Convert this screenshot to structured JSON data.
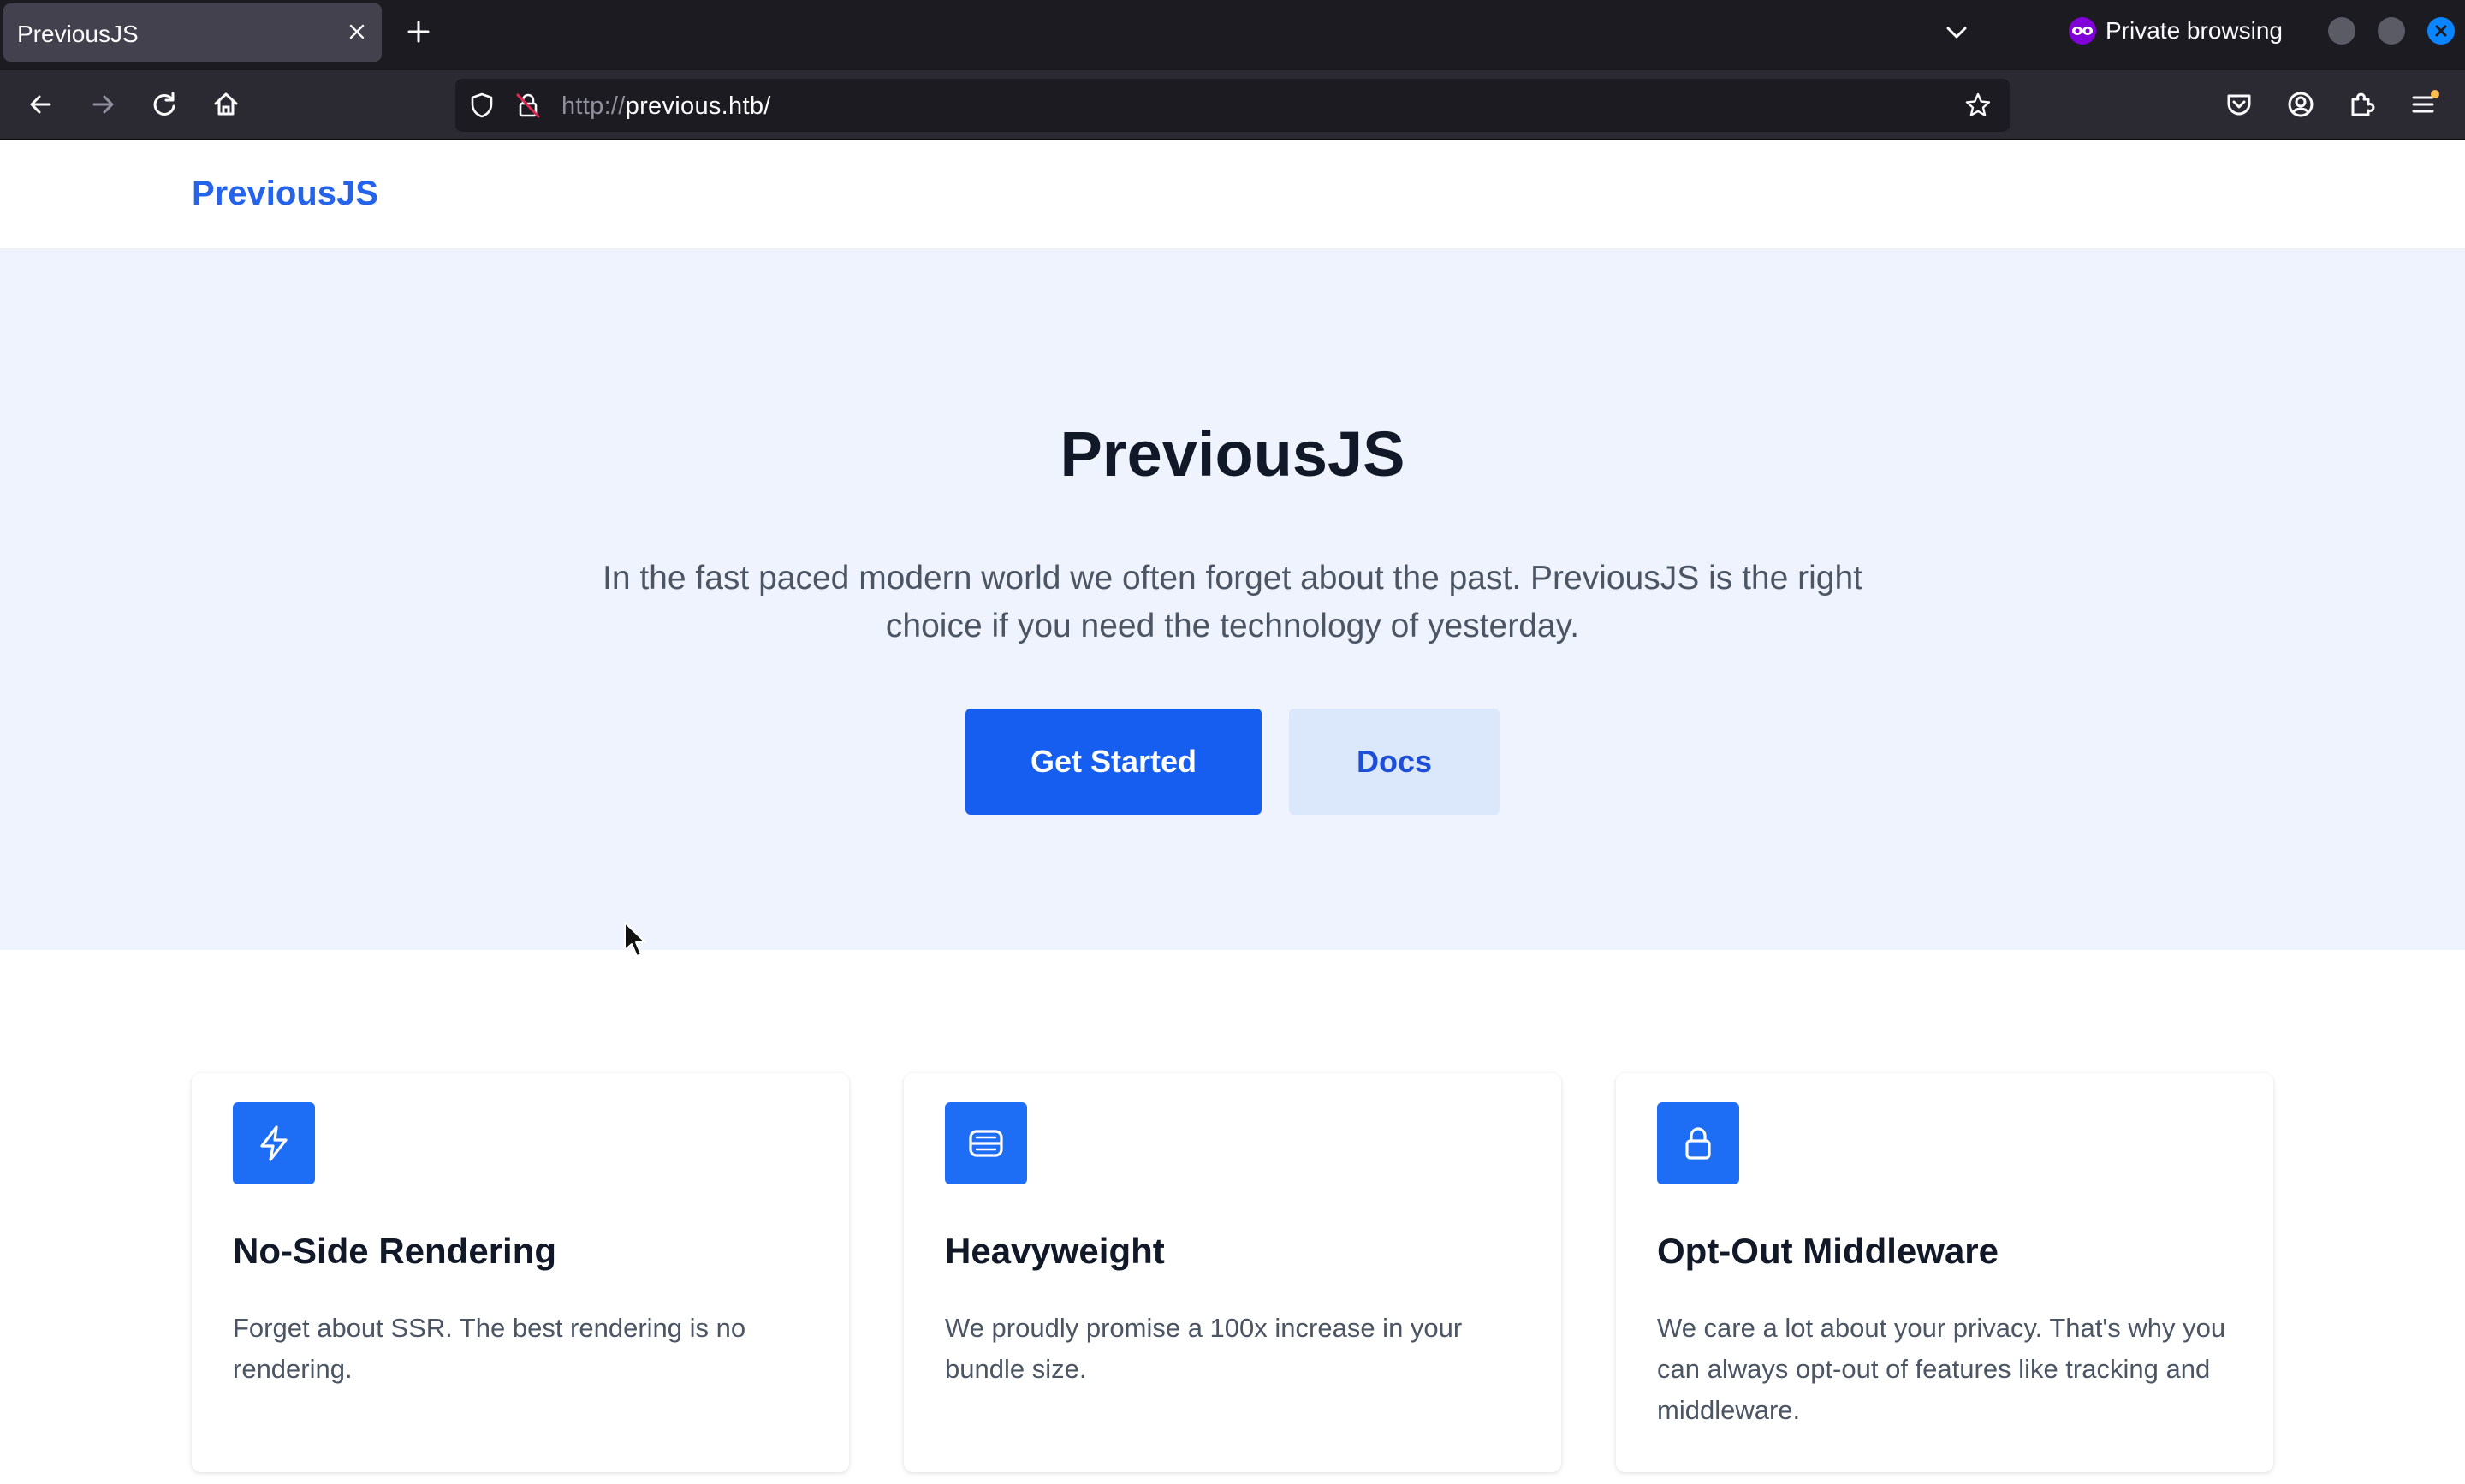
{
  "browser": {
    "tab_title": "PreviousJS",
    "private_label": "Private browsing",
    "url_scheme": "http://",
    "url_host": "previous.htb/",
    "icons": {
      "tab_close": "close-icon",
      "new_tab": "plus-icon",
      "tab_list": "chevron-down-icon",
      "back": "arrow-left-icon",
      "forward": "arrow-right-icon",
      "reload": "reload-icon",
      "home": "home-icon",
      "tracking": "shield-icon",
      "insecure": "lock-insecure-icon",
      "bookmark": "star-icon",
      "pocket": "pocket-icon",
      "account": "account-icon",
      "extensions": "puzzle-icon",
      "menu": "hamburger-icon"
    }
  },
  "header": {
    "brand": "PreviousJS"
  },
  "hero": {
    "title": "PreviousJS",
    "subtitle_line1": "In the fast paced modern world we often forget about the past. PreviousJS is the right",
    "subtitle_line2": "choice if you need the technology of yesterday.",
    "primary_button": "Get Started",
    "secondary_button": "Docs"
  },
  "features": [
    {
      "icon": "lightning-icon",
      "title": "No-Side Rendering",
      "description": "Forget about SSR. The best rendering is no rendering."
    },
    {
      "icon": "server-icon",
      "title": "Heavyweight",
      "description": "We proudly promise a 100x increase in your bundle size."
    },
    {
      "icon": "lock-icon",
      "title": "Opt-Out Middleware",
      "description": "We care a lot about your privacy. That's why you can always opt-out of features like tracking and middleware."
    }
  ],
  "colors": {
    "brand": "#2563eb",
    "primary_button": "#155eef",
    "hero_background": "#eef3fe",
    "feature_icon": "#1d6ef5"
  }
}
